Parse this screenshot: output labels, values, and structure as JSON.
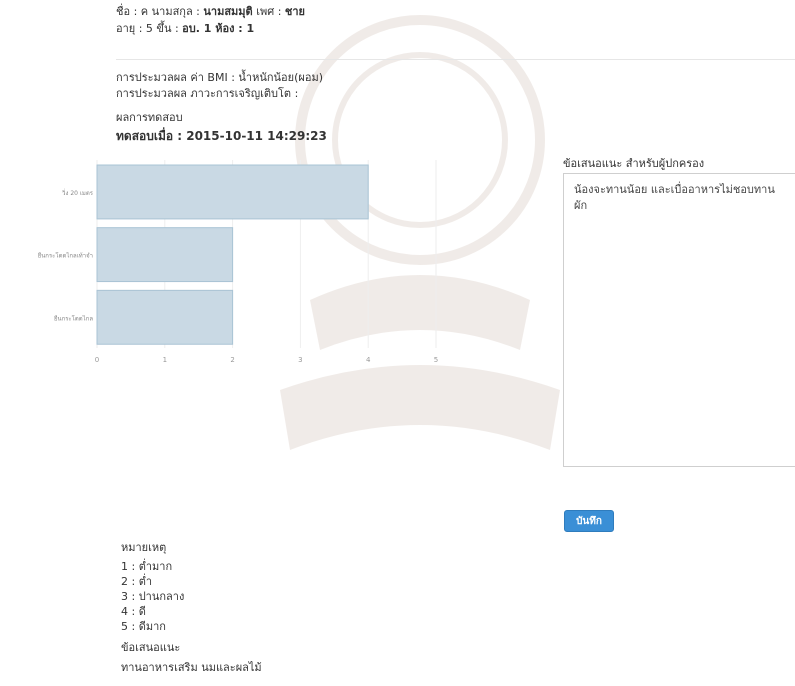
{
  "student": {
    "name_label": "ชื่อ : ค นามสกุล : ",
    "surname": "นามสมมุติ",
    "gender_label": " เพศ : ",
    "gender": "ชาย",
    "age_label": "อายุ : 5 ขึ้น : ",
    "class_value": "อบ. 1 ห้อง : 1"
  },
  "evaluation": {
    "bmi_line": "การประมวลผล ค่า BMI : น้ำหนักน้อย(ผอม)",
    "growth_line": "การประมวลผล ภาวะการเจริญเติบโต :",
    "results_heading": "ผลการทดสอบ",
    "tested_at_label": "ทดสอบเมื่อ : ",
    "tested_at": "2015-10-11 14:29:23"
  },
  "chart_data": {
    "type": "bar",
    "orientation": "horizontal",
    "categories": [
      "วิ่ง 20 เมตร",
      "ยืนกระโดดไกลเท้าจำ",
      "ยืนกระโดดไกล"
    ],
    "values": [
      4,
      2,
      2
    ],
    "xlim": [
      0,
      5
    ],
    "xticks": [
      0,
      1,
      2,
      3,
      4,
      5
    ],
    "grid": true,
    "bar_color": "#c9d9e4",
    "bar_border": "#a9c3d4"
  },
  "advice": {
    "label": "ข้อเสนอแนะ สำหรับผู้ปกครอง",
    "text": "น้องจะทานน้อย และเบื่ออาหารไม่ชอบทานผัก"
  },
  "save_button": "บันทึก",
  "notes": {
    "heading": "หมายเหตุ",
    "items": [
      "1 : ต่ำมาก",
      "2 : ต่ำ",
      "3 : ปานกลาง",
      "4 : ดี",
      "5 : ดีมาก"
    ],
    "advice_heading": "ข้อเสนอแนะ",
    "advice_text": "ทานอาหารเสริม นมและผลไม้"
  },
  "colors": {
    "accent": "#3a8fd6"
  }
}
